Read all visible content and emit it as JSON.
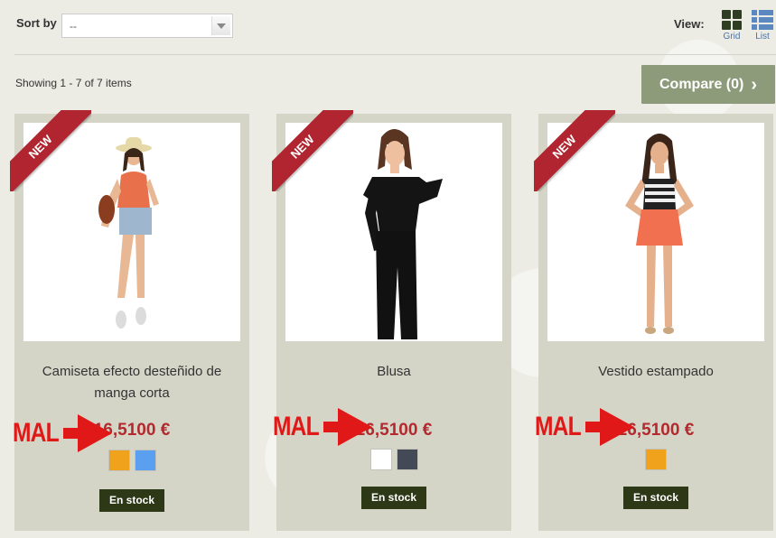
{
  "toolbar": {
    "sort_label": "Sort by",
    "sort_value": "--",
    "view_label": "View:",
    "grid_label": "Grid",
    "list_label": "List"
  },
  "listing": {
    "showing_text": "Showing 1 - 7 of 7 items",
    "compare_label": "Compare (0)"
  },
  "colors": {
    "price": "#b3292e",
    "ribbon": "#b0252f",
    "stock_button": "#2c3816",
    "compare_button": "#8d9b7a",
    "annotation": "#e01818"
  },
  "products": [
    {
      "badge": "NEW",
      "name": "Camiseta efecto desteñido de manga corta",
      "price": "16,5100 €",
      "stock": "En stock",
      "swatches": [
        "#f1a21c",
        "#5b9ff0"
      ],
      "annotation": "MAL"
    },
    {
      "badge": "NEW",
      "name": "Blusa",
      "price": "26,5100 €",
      "stock": "En stock",
      "swatches": [
        "#ffffff",
        "#434a55"
      ],
      "annotation": "MAL"
    },
    {
      "badge": "NEW",
      "name": "Vestido estampado",
      "price": "26,5100 €",
      "stock": "En stock",
      "swatches": [
        "#f1a21c"
      ],
      "annotation": "MAL"
    }
  ]
}
